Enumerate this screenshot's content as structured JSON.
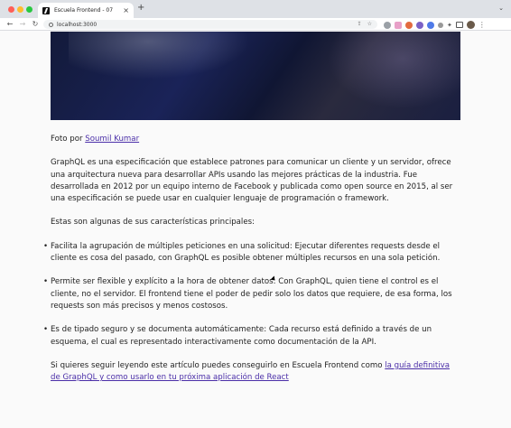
{
  "browser": {
    "tab_title": "Escuela Frontend - 07",
    "tab_close": "×",
    "new_tab": "+",
    "dropdown": "⌄",
    "url": "localhost:3000",
    "nav_back": "←",
    "nav_forward": "→",
    "reload": "↻",
    "menu": "⋮"
  },
  "article": {
    "photo_credit_prefix": "Foto por ",
    "photo_credit_author": "Soumil Kumar",
    "intro": "GraphQL es una especificación que establece patrones para comunicar un cliente y un servidor, ofrece una arquitectura nueva para desarrollar APIs usando las mejores prácticas de la industria. Fue desarrollada en 2012 por un equipo interno de Facebook y publicada como open source en 2015, al ser una especificación se puede usar en cualquier lenguaje de programación o framework.",
    "features_intro": "Estas son algunas de sus características principales:",
    "features": [
      "Facilita la agrupación de múltiples peticiones en una solicitud: Ejecutar diferentes requests desde el cliente es cosa del pasado, con GraphQL es posible obtener múltiples recursos en una sola petición.",
      "Permite ser flexible y explícito a la hora de obtener datos: Con GraphQL, quien tiene el control es el cliente, no el servidor. El frontend tiene el poder de pedir solo los datos que requiere, de esa forma, los requests son más precisos y menos costosos.",
      "Es de tipado seguro y se documenta automáticamente: Cada recurso está definido a través de un esquema, el cual es representado interactivamente como documentación de la API."
    ],
    "outro_prefix": "Si quieres seguir leyendo este artículo puedes conseguirlo en Escuela Frontend como ",
    "outro_link": "la guía definitiva de GraphQL y como usarlo en tu próxima aplicación de React"
  }
}
